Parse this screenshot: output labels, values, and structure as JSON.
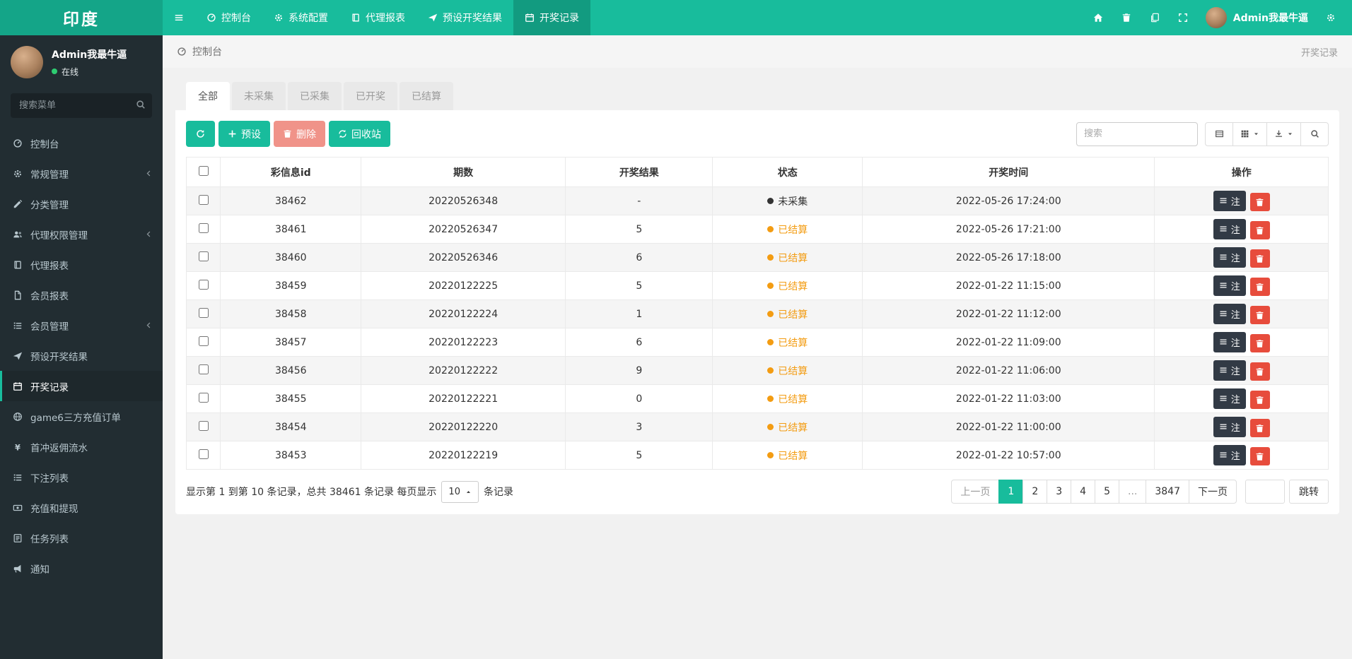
{
  "navbar": {
    "brand": "印度",
    "menu": [
      {
        "label": "控制台",
        "icon": "dashboard-icon",
        "active": false
      },
      {
        "label": "系统配置",
        "icon": "gear-icon",
        "active": false
      },
      {
        "label": "代理报表",
        "icon": "book-icon",
        "active": false
      },
      {
        "label": "预设开奖结果",
        "icon": "send-icon",
        "active": false
      },
      {
        "label": "开奖记录",
        "icon": "calendar-icon",
        "active": true
      }
    ],
    "quick_icons": [
      "home-icon",
      "trash-icon",
      "copy-icon",
      "expand-icon"
    ],
    "username": "Admin我最牛逼",
    "user_menu_icon": "gear-icon"
  },
  "sidebar": {
    "user": {
      "name": "Admin我最牛逼",
      "status": "在线"
    },
    "search_placeholder": "搜索菜单",
    "menu": [
      {
        "label": "控制台",
        "icon": "dashboard-icon",
        "active": false,
        "chevron": false
      },
      {
        "label": "常规管理",
        "icon": "gear-icon",
        "active": false,
        "chevron": true
      },
      {
        "label": "分类管理",
        "icon": "pencil-icon",
        "active": false,
        "chevron": false
      },
      {
        "label": "代理权限管理",
        "icon": "users-icon",
        "active": false,
        "chevron": true
      },
      {
        "label": "代理报表",
        "icon": "book-icon",
        "active": false,
        "chevron": false
      },
      {
        "label": "会员报表",
        "icon": "file-icon",
        "active": false,
        "chevron": false
      },
      {
        "label": "会员管理",
        "icon": "list-icon",
        "active": false,
        "chevron": true
      },
      {
        "label": "预设开奖结果",
        "icon": "send-icon",
        "active": false,
        "chevron": false
      },
      {
        "label": "开奖记录",
        "icon": "calendar-icon",
        "active": true,
        "chevron": false
      },
      {
        "label": "game6三方充值订单",
        "icon": "globe-icon",
        "active": false,
        "chevron": false
      },
      {
        "label": "首冲返佣流水",
        "icon": "yen-icon",
        "active": false,
        "chevron": false
      },
      {
        "label": "下注列表",
        "icon": "list-icon",
        "active": false,
        "chevron": false
      },
      {
        "label": "充值和提现",
        "icon": "money-icon",
        "active": false,
        "chevron": false
      },
      {
        "label": "任务列表",
        "icon": "tasks-icon",
        "active": false,
        "chevron": false
      },
      {
        "label": "通知",
        "icon": "bullhorn-icon",
        "active": false,
        "chevron": false
      }
    ]
  },
  "breadcrumb": {
    "left": "控制台",
    "left_icon": "dashboard-icon",
    "right": "开奖记录"
  },
  "tabs": [
    {
      "label": "全部",
      "active": true
    },
    {
      "label": "未采集",
      "active": false
    },
    {
      "label": "已采集",
      "active": false
    },
    {
      "label": "已开奖",
      "active": false
    },
    {
      "label": "已结算",
      "active": false
    }
  ],
  "toolbar": {
    "refresh_icon": "refresh-icon",
    "preset_label": "预设",
    "delete_label": "删除",
    "recycle_label": "回收站",
    "search_placeholder": "搜索"
  },
  "table": {
    "columns": [
      "彩信息id",
      "期数",
      "开奖结果",
      "状态",
      "开奖时间",
      "操作"
    ],
    "note_label": "注",
    "rows": [
      {
        "id": "38462",
        "issue": "20220526348",
        "result": "-",
        "state": "未采集",
        "state_type": "pending",
        "time": "2022-05-26 17:24:00"
      },
      {
        "id": "38461",
        "issue": "20220526347",
        "result": "5",
        "state": "已结算",
        "state_type": "settled",
        "time": "2022-05-26 17:21:00"
      },
      {
        "id": "38460",
        "issue": "20220526346",
        "result": "6",
        "state": "已结算",
        "state_type": "settled",
        "time": "2022-05-26 17:18:00"
      },
      {
        "id": "38459",
        "issue": "20220122225",
        "result": "5",
        "state": "已结算",
        "state_type": "settled",
        "time": "2022-01-22 11:15:00"
      },
      {
        "id": "38458",
        "issue": "20220122224",
        "result": "1",
        "state": "已结算",
        "state_type": "settled",
        "time": "2022-01-22 11:12:00"
      },
      {
        "id": "38457",
        "issue": "20220122223",
        "result": "6",
        "state": "已结算",
        "state_type": "settled",
        "time": "2022-01-22 11:09:00"
      },
      {
        "id": "38456",
        "issue": "20220122222",
        "result": "9",
        "state": "已结算",
        "state_type": "settled",
        "time": "2022-01-22 11:06:00"
      },
      {
        "id": "38455",
        "issue": "20220122221",
        "result": "0",
        "state": "已结算",
        "state_type": "settled",
        "time": "2022-01-22 11:03:00"
      },
      {
        "id": "38454",
        "issue": "20220122220",
        "result": "3",
        "state": "已结算",
        "state_type": "settled",
        "time": "2022-01-22 11:00:00"
      },
      {
        "id": "38453",
        "issue": "20220122219",
        "result": "5",
        "state": "已结算",
        "state_type": "settled",
        "time": "2022-01-22 10:57:00"
      }
    ]
  },
  "footer": {
    "summary_before": "显示第 1 到第 10 条记录，总共 38461 条记录 每页显示",
    "page_size": "10",
    "summary_after": "条记录",
    "pagination": {
      "prev": "上一页",
      "pages": [
        "1",
        "2",
        "3",
        "4",
        "5"
      ],
      "active": "1",
      "ellipsis": "...",
      "last": "3847",
      "next": "下一页",
      "jump_label": "跳转"
    }
  },
  "colors": {
    "accent_teal": "#18bc9c",
    "status_settled_orange": "#f39c12",
    "status_pending_dark": "#333333",
    "danger_red": "#e74c3c",
    "sidebar_dark": "#222d32"
  }
}
